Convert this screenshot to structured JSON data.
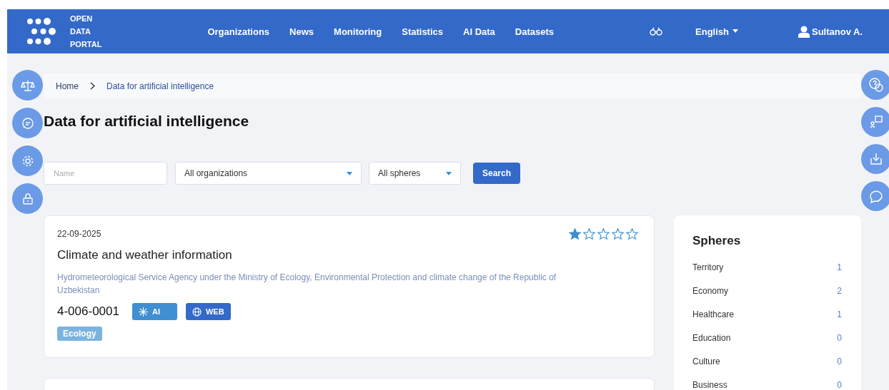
{
  "header": {
    "logo": [
      "OPEN",
      "DATA",
      "PORTAL"
    ],
    "nav": [
      {
        "label": "Organizations"
      },
      {
        "label": "News"
      },
      {
        "label": "Monitoring"
      },
      {
        "label": "Statistics"
      },
      {
        "label": "AI Data"
      },
      {
        "label": "Datasets"
      }
    ],
    "language": "English",
    "user": "Sultanov A."
  },
  "breadcrumb": [
    "Home",
    "Data for artificial intelligence"
  ],
  "title": "Data for artificial intelligence",
  "filters": {
    "name_placeholder": "Name",
    "organization": "All organizations",
    "sphere": "All spheres",
    "search_button": "Search"
  },
  "datasets": [
    {
      "date": "22-09-2025",
      "stars": 1,
      "title": "Climate and weather information",
      "organization": "Hydrometeorological Service Agency under the Ministry of Ecology, Environmental Protection and climate change of the Republic of Uzbekistan",
      "code": "4-006-0001",
      "badges": [
        {
          "kind": "ai",
          "label": "AI"
        },
        {
          "kind": "web",
          "label": "WEB"
        }
      ],
      "tags": [
        "Ecology"
      ]
    }
  ],
  "spheres": {
    "title": "Spheres",
    "items": [
      {
        "name": "Territory",
        "count": "1"
      },
      {
        "name": "Economy",
        "count": "2"
      },
      {
        "name": "Healthcare",
        "count": "1"
      },
      {
        "name": "Education",
        "count": "0"
      },
      {
        "name": "Culture",
        "count": "0"
      },
      {
        "name": "Business",
        "count": "0"
      }
    ]
  }
}
